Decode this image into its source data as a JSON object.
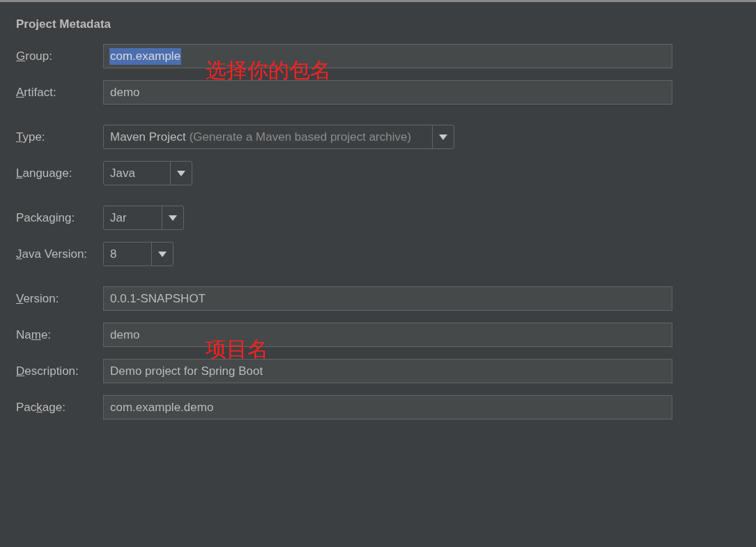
{
  "section_title": "Project Metadata",
  "groups": [
    [
      {
        "kind": "text",
        "mnemonic": "G",
        "label_after": "roup:",
        "value": "com.example",
        "selected_text": true,
        "annotation": "选择你的包名"
      },
      {
        "kind": "text",
        "mnemonic": "A",
        "label_after": "rtifact:",
        "value": "demo",
        "selected_text": false
      }
    ],
    [
      {
        "kind": "dropdown",
        "mnemonic": "T",
        "label_after": "ype:",
        "value": "Maven Project",
        "hint": "(Generate a Maven based project archive)"
      },
      {
        "kind": "dropdown",
        "mnemonic": "L",
        "label_after": "anguage:",
        "value": "Java"
      }
    ],
    [
      {
        "kind": "dropdown",
        "label_before": "Packa",
        "mnemonic": "g",
        "label_after": "ing:",
        "value": "Jar"
      },
      {
        "kind": "dropdown",
        "mnemonic": "J",
        "label_after": "ava Version:",
        "value": "8"
      }
    ],
    [
      {
        "kind": "text",
        "mnemonic": "V",
        "label_after": "ersion:",
        "value": "0.0.1-SNAPSHOT",
        "selected_text": false
      },
      {
        "kind": "text",
        "label_before": "Na",
        "mnemonic": "m",
        "label_after": "e:",
        "value": "demo",
        "selected_text": false,
        "annotation": "项目名"
      },
      {
        "kind": "text",
        "mnemonic": "D",
        "label_after": "escription:",
        "value": "Demo project for Spring Boot",
        "selected_text": false
      },
      {
        "kind": "text",
        "label_before": "Pac",
        "mnemonic": "k",
        "label_after": "age:",
        "value": "com.example.demo",
        "selected_text": false
      }
    ]
  ]
}
